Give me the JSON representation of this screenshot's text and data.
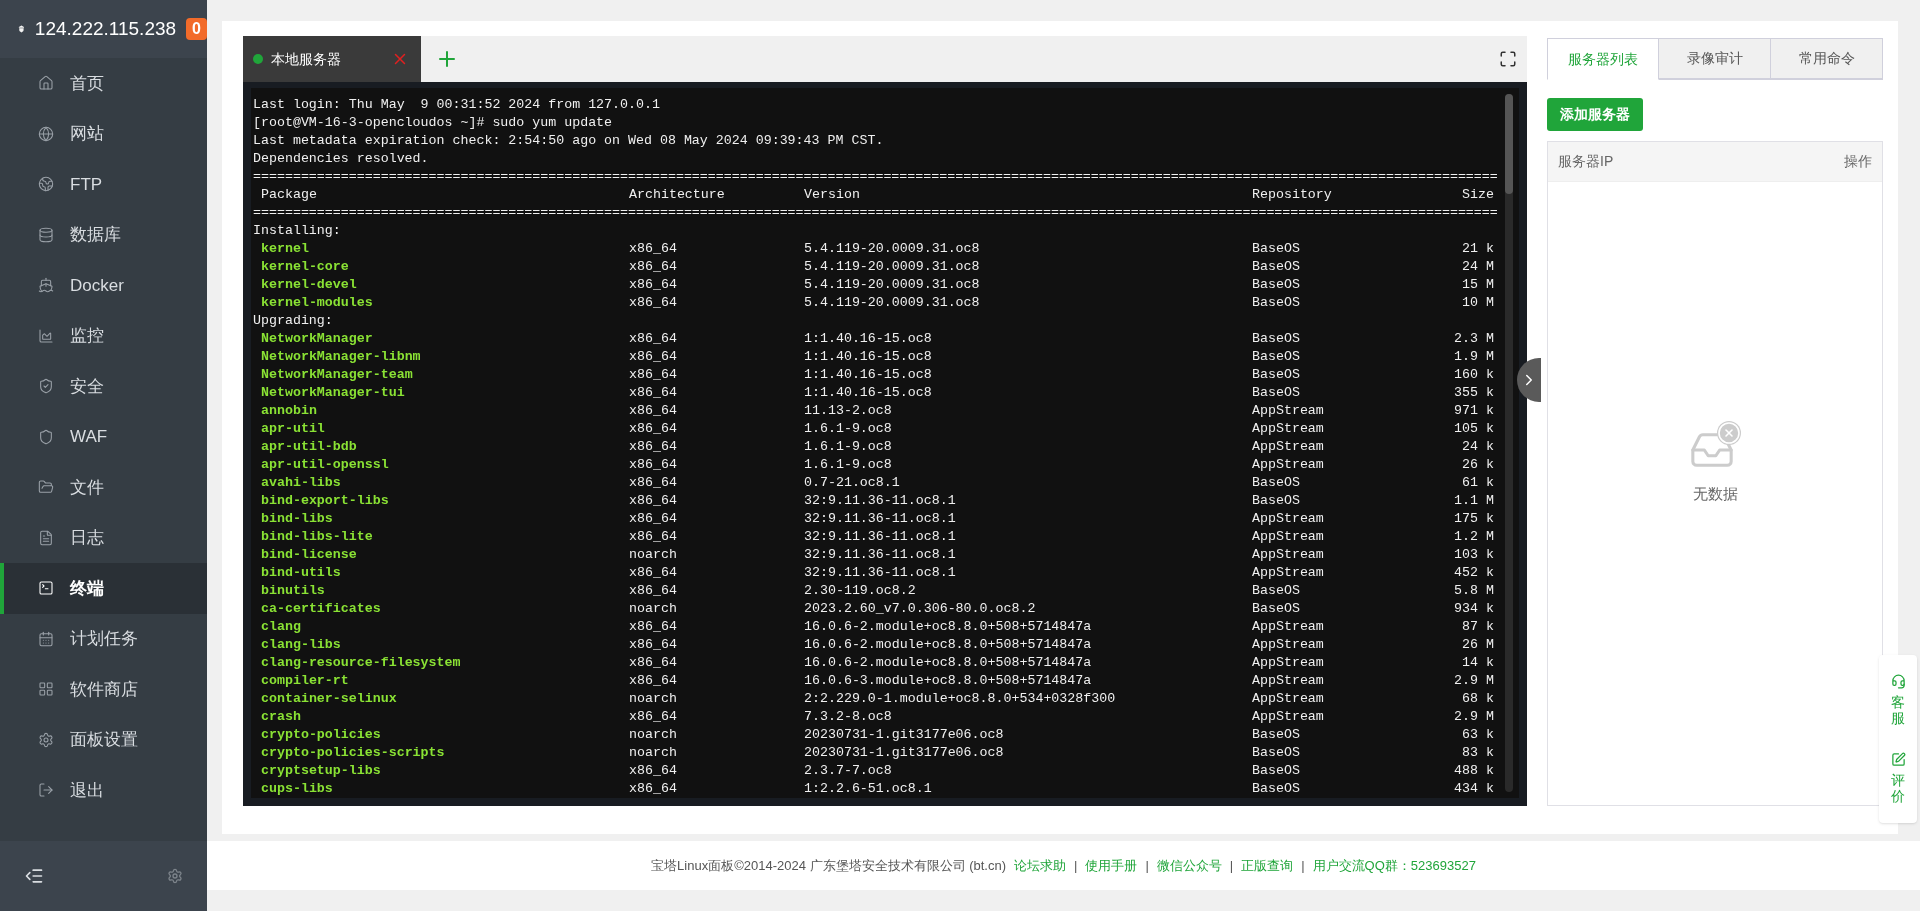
{
  "sidebar": {
    "host": "124.222.115.238",
    "badge": "0",
    "items": [
      {
        "label": "首页",
        "selected": false
      },
      {
        "label": "网站",
        "selected": false
      },
      {
        "label": "FTP",
        "selected": false
      },
      {
        "label": "数据库",
        "selected": false
      },
      {
        "label": "Docker",
        "selected": false
      },
      {
        "label": "监控",
        "selected": false
      },
      {
        "label": "安全",
        "selected": false
      },
      {
        "label": "WAF",
        "selected": false
      },
      {
        "label": "文件",
        "selected": false
      },
      {
        "label": "日志",
        "selected": false
      },
      {
        "label": "终端",
        "selected": true
      },
      {
        "label": "计划任务",
        "selected": false
      },
      {
        "label": "软件商店",
        "selected": false
      },
      {
        "label": "面板设置",
        "selected": false
      },
      {
        "label": "退出",
        "selected": false
      }
    ]
  },
  "terminal": {
    "tabs": [
      {
        "label": "本地服务器",
        "connected": true,
        "selected": true
      }
    ],
    "intro": [
      "Last login: Thu May  9 00:31:52 2024 from 127.0.0.1",
      "[root@VM-16-3-opencloudos ~]# sudo yum update",
      "Last metadata expiration check: 2:54:50 ago on Wed 08 May 2024 09:39:43 PM CST.",
      "Dependencies resolved."
    ],
    "separator": "============================================================================================================================================================",
    "columns": [
      "Package",
      "Architecture",
      "Version",
      "Repository",
      "Size"
    ],
    "sections": [
      {
        "label": "Installing:",
        "rows": [
          {
            "package": "kernel",
            "arch": "x86_64",
            "version": "5.4.119-20.0009.31.oc8",
            "repo": "BaseOS",
            "size": "21 k"
          },
          {
            "package": "kernel-core",
            "arch": "x86_64",
            "version": "5.4.119-20.0009.31.oc8",
            "repo": "BaseOS",
            "size": "24 M"
          },
          {
            "package": "kernel-devel",
            "arch": "x86_64",
            "version": "5.4.119-20.0009.31.oc8",
            "repo": "BaseOS",
            "size": "15 M"
          },
          {
            "package": "kernel-modules",
            "arch": "x86_64",
            "version": "5.4.119-20.0009.31.oc8",
            "repo": "BaseOS",
            "size": "10 M"
          }
        ]
      },
      {
        "label": "Upgrading:",
        "rows": [
          {
            "package": "NetworkManager",
            "arch": "x86_64",
            "version": "1:1.40.16-15.oc8",
            "repo": "BaseOS",
            "size": "2.3 M"
          },
          {
            "package": "NetworkManager-libnm",
            "arch": "x86_64",
            "version": "1:1.40.16-15.oc8",
            "repo": "BaseOS",
            "size": "1.9 M"
          },
          {
            "package": "NetworkManager-team",
            "arch": "x86_64",
            "version": "1:1.40.16-15.oc8",
            "repo": "BaseOS",
            "size": "160 k"
          },
          {
            "package": "NetworkManager-tui",
            "arch": "x86_64",
            "version": "1:1.40.16-15.oc8",
            "repo": "BaseOS",
            "size": "355 k"
          },
          {
            "package": "annobin",
            "arch": "x86_64",
            "version": "11.13-2.oc8",
            "repo": "AppStream",
            "size": "971 k"
          },
          {
            "package": "apr-util",
            "arch": "x86_64",
            "version": "1.6.1-9.oc8",
            "repo": "AppStream",
            "size": "105 k"
          },
          {
            "package": "apr-util-bdb",
            "arch": "x86_64",
            "version": "1.6.1-9.oc8",
            "repo": "AppStream",
            "size": "24 k"
          },
          {
            "package": "apr-util-openssl",
            "arch": "x86_64",
            "version": "1.6.1-9.oc8",
            "repo": "AppStream",
            "size": "26 k"
          },
          {
            "package": "avahi-libs",
            "arch": "x86_64",
            "version": "0.7-21.oc8.1",
            "repo": "BaseOS",
            "size": "61 k"
          },
          {
            "package": "bind-export-libs",
            "arch": "x86_64",
            "version": "32:9.11.36-11.oc8.1",
            "repo": "BaseOS",
            "size": "1.1 M"
          },
          {
            "package": "bind-libs",
            "arch": "x86_64",
            "version": "32:9.11.36-11.oc8.1",
            "repo": "AppStream",
            "size": "175 k"
          },
          {
            "package": "bind-libs-lite",
            "arch": "x86_64",
            "version": "32:9.11.36-11.oc8.1",
            "repo": "AppStream",
            "size": "1.2 M"
          },
          {
            "package": "bind-license",
            "arch": "noarch",
            "version": "32:9.11.36-11.oc8.1",
            "repo": "AppStream",
            "size": "103 k"
          },
          {
            "package": "bind-utils",
            "arch": "x86_64",
            "version": "32:9.11.36-11.oc8.1",
            "repo": "AppStream",
            "size": "452 k"
          },
          {
            "package": "binutils",
            "arch": "x86_64",
            "version": "2.30-119.oc8.2",
            "repo": "BaseOS",
            "size": "5.8 M"
          },
          {
            "package": "ca-certificates",
            "arch": "noarch",
            "version": "2023.2.60_v7.0.306-80.0.oc8.2",
            "repo": "BaseOS",
            "size": "934 k"
          },
          {
            "package": "clang",
            "arch": "x86_64",
            "version": "16.0.6-2.module+oc8.8.0+508+5714847a",
            "repo": "AppStream",
            "size": "87 k"
          },
          {
            "package": "clang-libs",
            "arch": "x86_64",
            "version": "16.0.6-2.module+oc8.8.0+508+5714847a",
            "repo": "AppStream",
            "size": "26 M"
          },
          {
            "package": "clang-resource-filesystem",
            "arch": "x86_64",
            "version": "16.0.6-2.module+oc8.8.0+508+5714847a",
            "repo": "AppStream",
            "size": "14 k"
          },
          {
            "package": "compiler-rt",
            "arch": "x86_64",
            "version": "16.0.6-3.module+oc8.8.0+508+5714847a",
            "repo": "AppStream",
            "size": "2.9 M"
          },
          {
            "package": "container-selinux",
            "arch": "noarch",
            "version": "2:2.229.0-1.module+oc8.8.0+534+0328f300",
            "repo": "AppStream",
            "size": "68 k"
          },
          {
            "package": "crash",
            "arch": "x86_64",
            "version": "7.3.2-8.oc8",
            "repo": "AppStream",
            "size": "2.9 M"
          },
          {
            "package": "crypto-policies",
            "arch": "noarch",
            "version": "20230731-1.git3177e06.oc8",
            "repo": "BaseOS",
            "size": "63 k"
          },
          {
            "package": "crypto-policies-scripts",
            "arch": "noarch",
            "version": "20230731-1.git3177e06.oc8",
            "repo": "BaseOS",
            "size": "83 k"
          },
          {
            "package": "cryptsetup-libs",
            "arch": "x86_64",
            "version": "2.3.7-7.oc8",
            "repo": "BaseOS",
            "size": "488 k"
          },
          {
            "package": "cups-libs",
            "arch": "x86_64",
            "version": "1:2.2.6-51.oc8.1",
            "repo": "BaseOS",
            "size": "434 k"
          }
        ]
      }
    ]
  },
  "panel": {
    "tabs": [
      {
        "label": "服务器列表",
        "selected": true
      },
      {
        "label": "录像审计",
        "selected": false
      },
      {
        "label": "常用命令",
        "selected": false
      }
    ],
    "add_button": "添加服务器",
    "columns": [
      "服务器IP",
      "操作"
    ],
    "empty": "无数据"
  },
  "float_widget": [
    {
      "label": "客服"
    },
    {
      "label": "评价"
    }
  ],
  "footer": {
    "copyright": "宝塔Linux面板©2014-2024 广东堡塔安全技术有限公司 (bt.cn)",
    "separator": "|",
    "links": [
      "论坛求助",
      "使用手册",
      "微信公众号",
      "正版查询",
      "用户交流QQ群：523693527"
    ]
  }
}
